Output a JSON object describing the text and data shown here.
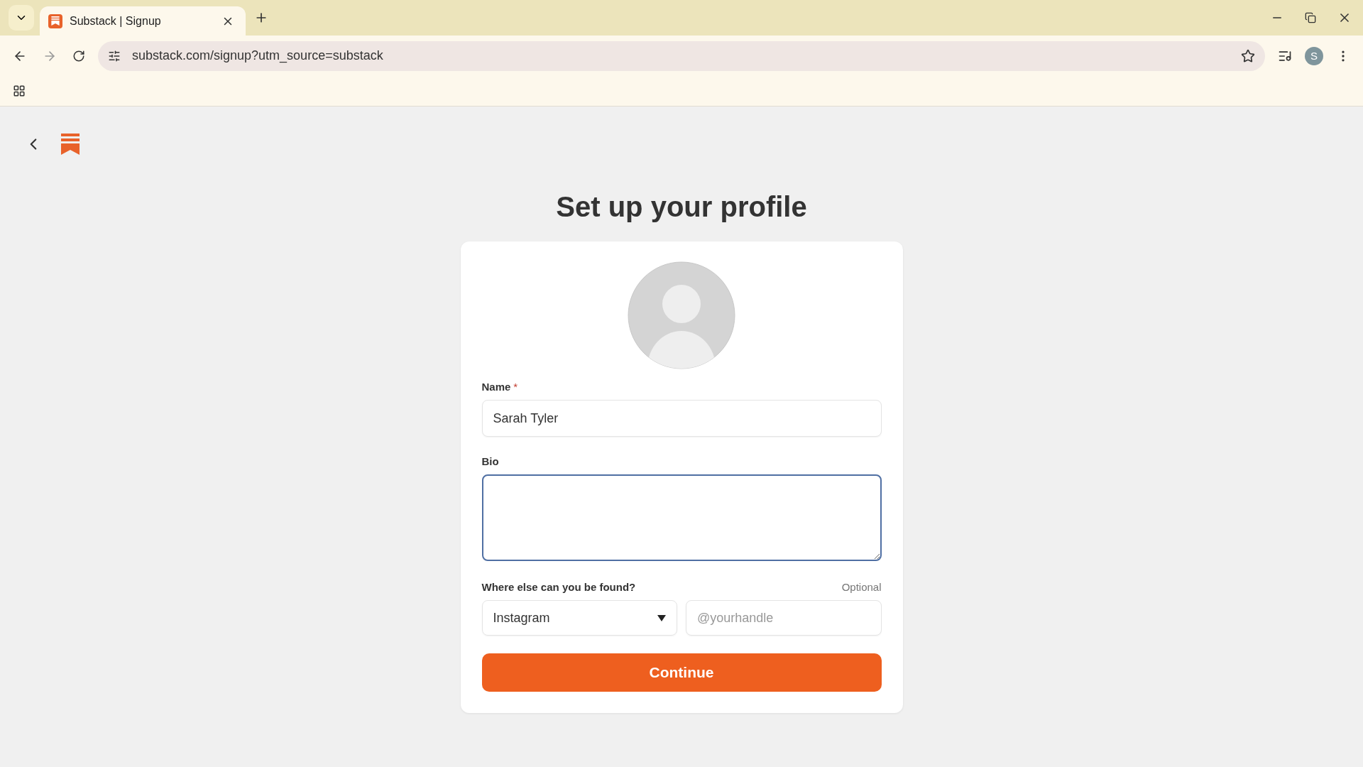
{
  "browser": {
    "tabs": [
      {
        "title": "Substack | Signup",
        "selected": true
      }
    ],
    "url": "substack.com/signup?utm_source=substack",
    "profile_initial": "S"
  },
  "page": {
    "title": "Set up your profile",
    "name_field": {
      "label": "Name",
      "required_mark": "*",
      "value": "Sarah Tyler"
    },
    "bio_field": {
      "label": "Bio",
      "focused": true
    },
    "links": {
      "label": "Where else can you be found?",
      "hint": "Optional",
      "platform": "Instagram",
      "placeholder": "@yourhandle"
    },
    "continue_button": "Continue"
  }
}
